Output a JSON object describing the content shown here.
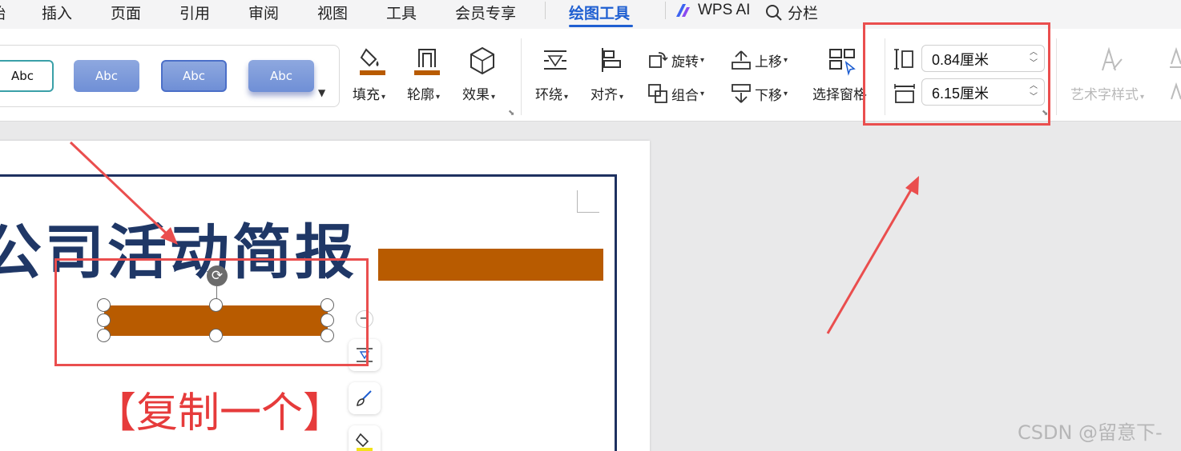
{
  "menu": {
    "items": [
      "始",
      "插入",
      "页面",
      "引用",
      "审阅",
      "视图",
      "工具",
      "会员专享",
      "绘图工具",
      "WPS AI",
      "分栏"
    ],
    "active": "绘图工具"
  },
  "ribbon": {
    "style_gallery": [
      "Abc",
      "Abc",
      "Abc",
      "Abc"
    ],
    "fill_label": "填充",
    "outline_label": "轮廓",
    "effect_label": "效果",
    "wrap_label": "环绕",
    "align_label": "对齐",
    "rotate_label": "旋转",
    "group_label": "组合",
    "bring_forward_label": "上移",
    "send_backward_label": "下移",
    "selection_pane_label": "选择窗格",
    "height_value": "0.84厘米",
    "width_value": "6.15厘米",
    "wordart_label": "艺术字样式"
  },
  "document": {
    "title": "公司活动简报",
    "copy_note": "【复制一个】"
  },
  "watermark": "CSDN @留意下-",
  "colors": {
    "accent_blue": "#1f5fd1",
    "shape_orange": "#b85b00",
    "title_navy": "#1f3766",
    "annotation_red": "#ea4e4e"
  }
}
